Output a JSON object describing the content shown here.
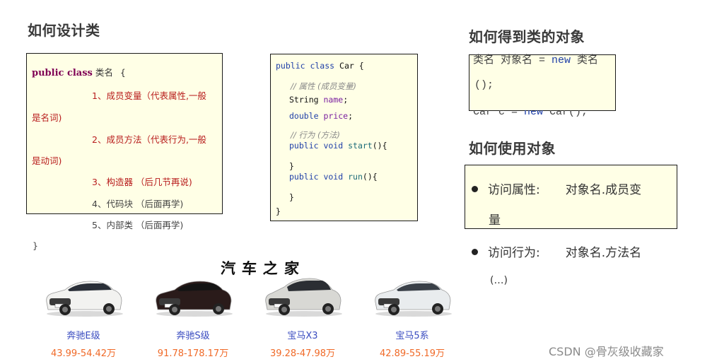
{
  "sections": {
    "design_class": {
      "title": "如何设计类",
      "template": {
        "keyword": "public class",
        "class_name": "类名",
        "open_brace": "{",
        "items": [
          {
            "text_line1": "1、成员变量（代表属性,一般",
            "text_line2": "是名词)",
            "color": "red"
          },
          {
            "text_line1": "2、成员方法（代表行为,一般",
            "text_line2": "是动词)",
            "color": "red"
          },
          {
            "text_line1": "3、构造器  （后几节再说)",
            "color": "red"
          },
          {
            "text_line1": "4、代码块  （后面再学)",
            "color": "gray"
          },
          {
            "text_line1": "5、内部类  （后面再学)",
            "color": "gray"
          }
        ],
        "close_brace": "}"
      },
      "example": {
        "line1": {
          "kw": "public class",
          "rest": "Car {"
        },
        "comment_fields": "// 属性 (成员变量)",
        "field1": {
          "type": "String",
          "name": "name",
          "end": ";"
        },
        "field2": {
          "type": "double",
          "name": "price",
          "end": ";"
        },
        "comment_methods": "// 行为 (方法)",
        "method1": {
          "kw": "public void",
          "name": "start",
          "rest": "(){"
        },
        "method1_close": "}",
        "method2": {
          "kw": "public void",
          "name": "run",
          "rest": "(){"
        },
        "method2_close": "}",
        "class_close": "}"
      }
    },
    "get_object": {
      "title": "如何得到类的对象",
      "syntax_a": "类名 对象名 = ",
      "syntax_new": "new",
      "syntax_b": " 类名",
      "syntax_c": "();",
      "example_a": "Car c = ",
      "example_new": "new",
      "example_b": " Car();"
    },
    "use_object": {
      "title": "如何使用对象",
      "bullets": [
        {
          "label": "访问属性:",
          "value": "对象名.成员变",
          "value_cont": "量"
        },
        {
          "label": "访问行为:",
          "value": "对象名.方法名",
          "value_cont": "(…)"
        }
      ]
    }
  },
  "car_site": {
    "brand": "汽车之家",
    "cars": [
      {
        "name": "奔驰E级",
        "price": "43.99-54.42万",
        "body_color": "#f2f2f0",
        "window_color": "#2a2f38"
      },
      {
        "name": "奔驰S级",
        "price": "91.78-178.17万",
        "body_color": "#2a1b1a",
        "window_color": "#141414"
      },
      {
        "name": "宝马X3",
        "price": "39.28-47.98万",
        "body_color": "#d8d8d4",
        "window_color": "#2b2e33"
      },
      {
        "name": "宝马5系",
        "price": "42.89-55.19万",
        "body_color": "#e9ecee",
        "window_color": "#3a4048"
      }
    ]
  },
  "watermark": "CSDN @骨灰级收藏家",
  "colors": {
    "box_bg": "#ffffe6",
    "keyword": "#7f0055",
    "highlight_red": "#b81c1c",
    "car_name": "#3a4cc0",
    "car_price": "#f06a28"
  }
}
